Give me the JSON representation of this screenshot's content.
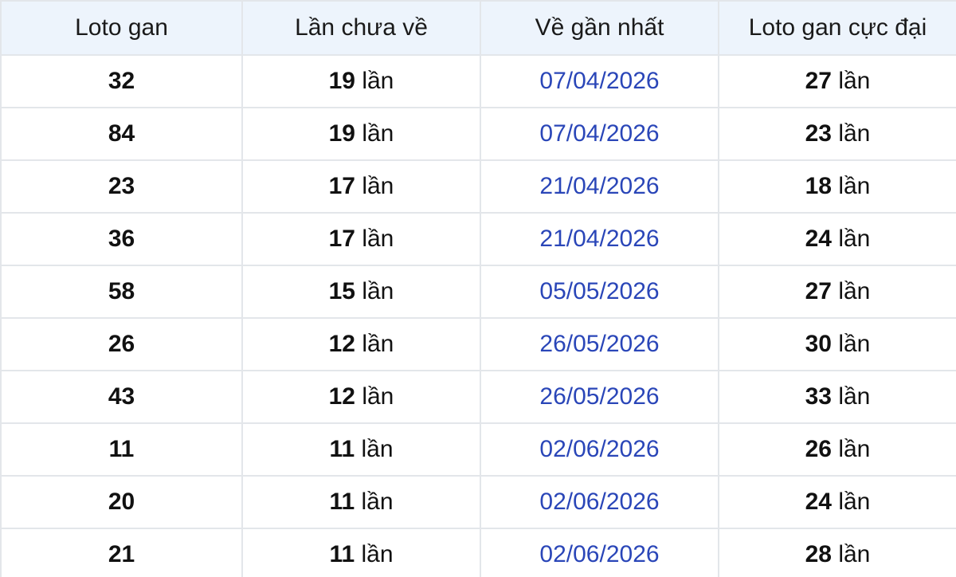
{
  "table": {
    "headers": [
      "Loto gan",
      "Lần chưa về",
      "Về gần nhất",
      "Loto gan cực đại"
    ],
    "unit": "lần",
    "rows": [
      {
        "loto": "32",
        "count": "19",
        "last_date": "07/04/2026",
        "max": "27"
      },
      {
        "loto": "84",
        "count": "19",
        "last_date": "07/04/2026",
        "max": "23"
      },
      {
        "loto": "23",
        "count": "17",
        "last_date": "21/04/2026",
        "max": "18"
      },
      {
        "loto": "36",
        "count": "17",
        "last_date": "21/04/2026",
        "max": "24"
      },
      {
        "loto": "58",
        "count": "15",
        "last_date": "05/05/2026",
        "max": "27"
      },
      {
        "loto": "26",
        "count": "12",
        "last_date": "26/05/2026",
        "max": "30"
      },
      {
        "loto": "43",
        "count": "12",
        "last_date": "26/05/2026",
        "max": "33"
      },
      {
        "loto": "11",
        "count": "11",
        "last_date": "02/06/2026",
        "max": "26"
      },
      {
        "loto": "20",
        "count": "11",
        "last_date": "02/06/2026",
        "max": "24"
      },
      {
        "loto": "21",
        "count": "11",
        "last_date": "02/06/2026",
        "max": "28"
      }
    ]
  },
  "colors": {
    "header_bg": "#edf4fc",
    "border": "#e3e6ea",
    "date_text": "#2a46b8",
    "body_text": "#111111"
  }
}
